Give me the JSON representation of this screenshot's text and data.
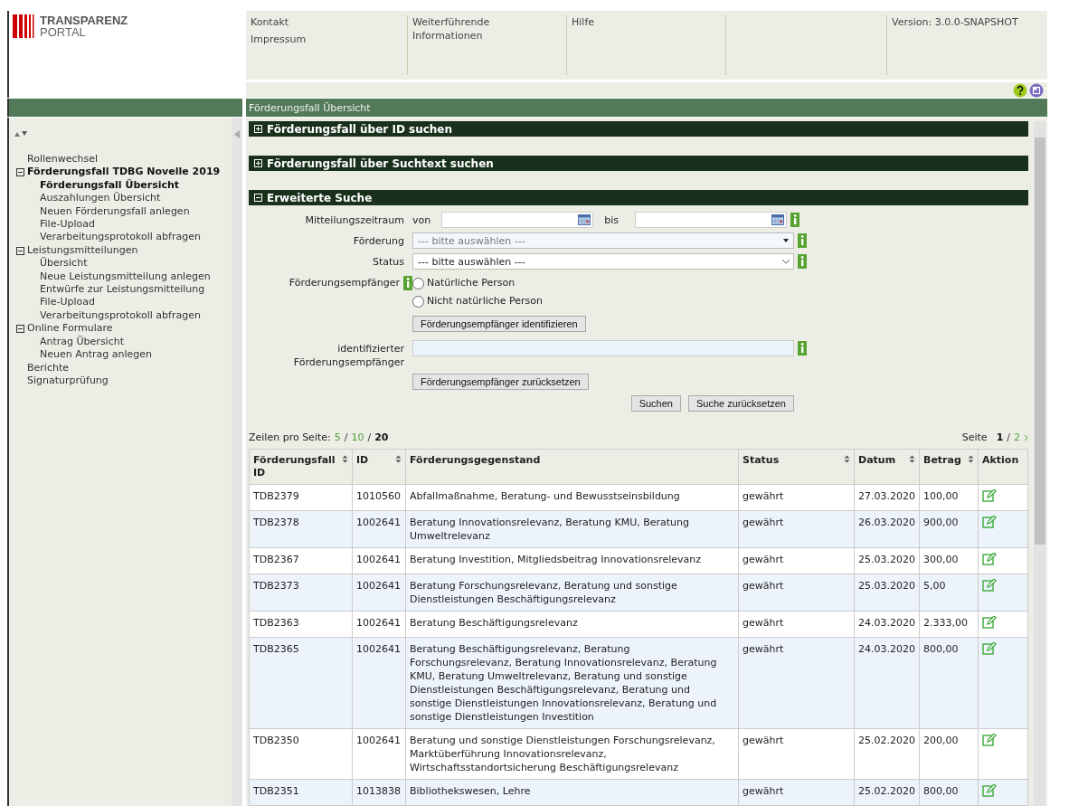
{
  "logo": {
    "line1": "TRANSPARENZ",
    "line2": "PORTAL"
  },
  "header": {
    "link_columns": [
      {
        "links": [
          "Kontakt",
          "Impressum"
        ]
      },
      {
        "links": [
          "Weiterführende Informationen"
        ]
      },
      {
        "links": [
          "Hilfe"
        ]
      }
    ],
    "version": "Version: 3.0.0-SNAPSHOT"
  },
  "page_title": "Förderungsfall Übersicht",
  "sidebar": {
    "items": [
      {
        "label": "Rollenwechsel",
        "selected": false
      },
      {
        "label": "Förderungsfall TDBG Novelle 2019",
        "selected": true,
        "expanded": true,
        "children": [
          {
            "label": "Förderungsfall Übersicht",
            "selected": true
          },
          {
            "label": "Auszahlungen Übersicht",
            "selected": false
          },
          {
            "label": "Neuen Förderungsfall anlegen",
            "selected": false
          },
          {
            "label": "File-Upload",
            "selected": false
          },
          {
            "label": "Verarbeitungsprotokoll abfragen",
            "selected": false
          }
        ]
      },
      {
        "label": "Leistungsmitteilungen",
        "selected": false,
        "expanded": true,
        "children": [
          {
            "label": "Übersicht",
            "selected": false
          },
          {
            "label": "Neue Leistungsmitteilung anlegen",
            "selected": false
          },
          {
            "label": "Entwürfe zur Leistungsmitteilung",
            "selected": false
          },
          {
            "label": "File-Upload",
            "selected": false
          },
          {
            "label": "Verarbeitungsprotokoll abfragen",
            "selected": false
          }
        ]
      },
      {
        "label": "Online Formulare",
        "selected": false,
        "expanded": true,
        "children": [
          {
            "label": "Antrag Übersicht",
            "selected": false
          },
          {
            "label": "Neuen Antrag anlegen",
            "selected": false
          }
        ]
      },
      {
        "label": "Berichte",
        "selected": false
      },
      {
        "label": "Signaturprüfung",
        "selected": false
      }
    ]
  },
  "sections": [
    {
      "title": "Förderungsfall über ID suchen",
      "expanded": false
    },
    {
      "title": "Förderungsfall über Suchtext suchen",
      "expanded": false
    },
    {
      "title": "Erweiterte Suche",
      "expanded": true
    }
  ],
  "search_form": {
    "period": {
      "label": "Mitteilungszeitraum",
      "from_label": "von",
      "to_label": "bis"
    },
    "foerderung": {
      "label": "Förderung",
      "value": "--- bitte auswählen ---",
      "disabled": true
    },
    "status": {
      "label": "Status",
      "value": "--- bitte auswählen ---",
      "disabled": false
    },
    "recipient": {
      "label": "Förderungsempfänger",
      "options": [
        {
          "label": "Natürliche Person",
          "selected": false
        },
        {
          "label": "Nicht natürliche Person",
          "selected": false
        }
      ],
      "identify_button": "Förderungsempfänger identifizieren"
    },
    "identified": {
      "label": "identifizierter Förderungsempfänger",
      "reset_button": "Förderungsempfänger zurücksetzen"
    },
    "buttons": [
      "Suchen",
      "Suche zurücksetzen"
    ]
  },
  "pagination": {
    "rows_label": "Zeilen pro Seite:",
    "sizes": [
      {
        "label": "5",
        "selected": false
      },
      {
        "separator": "/",
        "label": "10",
        "selected": false
      },
      {
        "separator": "/",
        "label": "20",
        "selected": true
      }
    ],
    "page_label": "Seite",
    "pages": [
      {
        "label": "1",
        "selected": true
      },
      {
        "separator": "/",
        "label": "2",
        "selected": false
      }
    ]
  },
  "table": {
    "columns": [
      {
        "label": "Förderungsfall ID",
        "sortable": true
      },
      {
        "label": "ID",
        "sortable": true
      },
      {
        "label": "Förderungsgegenstand",
        "sortable": false
      },
      {
        "label": "Status",
        "sortable": true
      },
      {
        "label": "Datum",
        "sortable": true
      },
      {
        "label": "Betrag",
        "sortable": true
      },
      {
        "label": "Aktion",
        "sortable": false
      }
    ],
    "rows": [
      {
        "cells": [
          "TDB2379",
          "1010560",
          "Abfallmaßnahme, Beratung- und Bewusstseinsbildung",
          "gewährt",
          "27.03.2020",
          "100,00"
        ]
      },
      {
        "cells": [
          "TDB2378",
          "1002641",
          "Beratung Innovationsrelevanz, Beratung KMU, Beratung Umweltrelevanz",
          "gewährt",
          "26.03.2020",
          "900,00"
        ]
      },
      {
        "cells": [
          "TDB2367",
          "1002641",
          "Beratung Investition, Mitgliedsbeitrag Innovationsrelevanz",
          "gewährt",
          "25.03.2020",
          "300,00"
        ]
      },
      {
        "cells": [
          "TDB2373",
          "1002641",
          "Beratung Forschungsrelevanz, Beratung und sonstige Dienstleistungen Beschäftigungsrelevanz",
          "gewährt",
          "25.03.2020",
          "5,00"
        ]
      },
      {
        "cells": [
          "TDB2363",
          "1002641",
          "Beratung Beschäftigungsrelevanz",
          "gewährt",
          "24.03.2020",
          "2.333,00"
        ]
      },
      {
        "cells": [
          "TDB2365",
          "1002641",
          "Beratung Beschäftigungsrelevanz, Beratung Forschungsrelevanz, Beratung Innovationsrelevanz, Beratung KMU, Beratung Umweltrelevanz, Beratung und sonstige Dienstleistungen Beschäftigungsrelevanz, Beratung und sonstige Dienstleistungen Innovationsrelevanz, Beratung und sonstige Dienstleistungen Investition",
          "gewährt",
          "24.03.2020",
          "800,00"
        ]
      },
      {
        "cells": [
          "TDB2350",
          "1002641",
          "Beratung und sonstige Dienstleistungen Forschungsrelevanz, Marktüberführung Innovationsrelevanz, Wirtschaftsstandortsicherung Beschäftigungsrelevanz",
          "gewährt",
          "25.02.2020",
          "200,00"
        ]
      },
      {
        "cells": [
          "TDB2351",
          "1013838",
          "Bibliothekswesen, Lehre",
          "gewährt",
          "25.02.2020",
          "800,00"
        ]
      }
    ]
  }
}
